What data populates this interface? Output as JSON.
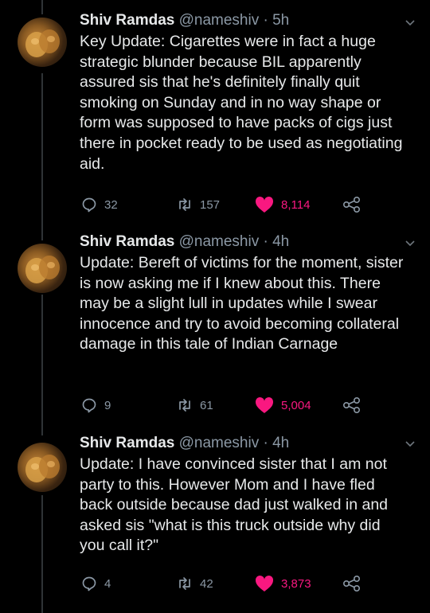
{
  "tweets": [
    {
      "name": "Shiv Ramdas",
      "handle": "@nameshiv",
      "sep": "·",
      "time": "5h",
      "text": "Key Update: Cigarettes were in fact a huge strategic blunder because BIL apparently assured sis that he's definitely finally quit smoking on Sunday and in no way shape or form was supposed to have packs of cigs just there in pocket ready to be used as negotiating aid.",
      "replies": "32",
      "retweets": "157",
      "likes": "8,114"
    },
    {
      "name": "Shiv Ramdas",
      "handle": "@nameshiv",
      "sep": "·",
      "time": "4h",
      "text": "Update: Bereft of victims for the moment, sister is now asking me if I knew about this. There may be a slight lull in updates while I swear innocence and try to avoid becoming collateral damage in this tale of Indian Carnage",
      "replies": "9",
      "retweets": "61",
      "likes": "5,004"
    },
    {
      "name": "Shiv Ramdas",
      "handle": "@nameshiv",
      "sep": "·",
      "time": "4h",
      "text": "Update: I have convinced sister that I am not party to this. However Mom and I have fled back outside because dad just walked in and asked sis \"what is this truck outside why did you call it?\"",
      "replies": "4",
      "retweets": "42",
      "likes": "3,873"
    }
  ],
  "icons": {
    "reply": "reply-icon",
    "retweet": "retweet-icon",
    "like": "heart-icon",
    "share": "share-icon",
    "more": "chevron-down-icon"
  },
  "colors": {
    "background": "#000000",
    "text": "#e7e9ea",
    "secondary": "#8b98a5",
    "like": "#f91880",
    "thread_line": "#2f3336"
  }
}
